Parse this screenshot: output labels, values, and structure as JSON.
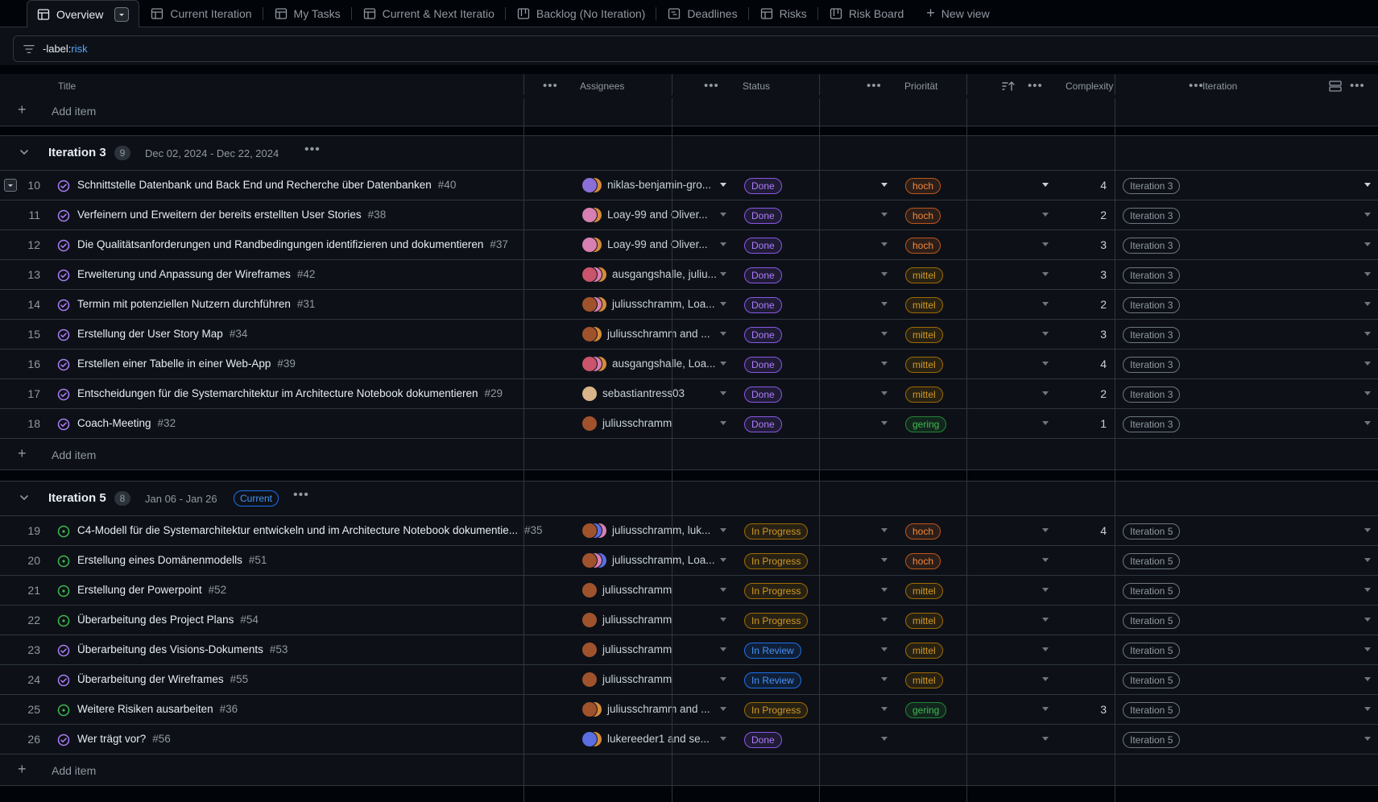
{
  "tabs": [
    {
      "label": "Overview",
      "icon": "table-icon",
      "active": true
    },
    {
      "label": "Current Iteration",
      "icon": "table-icon"
    },
    {
      "label": "My Tasks",
      "icon": "table-icon"
    },
    {
      "label": "Current & Next Iteratio",
      "icon": "table-icon"
    },
    {
      "label": "Backlog (No Iteration)",
      "icon": "board-icon"
    },
    {
      "label": "Deadlines",
      "icon": "roadmap-icon"
    },
    {
      "label": "Risks",
      "icon": "table-icon"
    },
    {
      "label": "Risk Board",
      "icon": "board-icon"
    }
  ],
  "new_view_label": "New view",
  "filter": {
    "key": "-label:",
    "value": "risk"
  },
  "columns": {
    "title": "Title",
    "assignees": "Assignees",
    "status": "Status",
    "priority": "Priorität",
    "complexity": "Complexity",
    "iteration": "Iteration"
  },
  "add_item_label": "Add item",
  "groups": [
    {
      "title": "Iteration 3",
      "count": "9",
      "dates": "Dec 02, 2024 - Dec 22, 2024",
      "badge": "",
      "items": [
        {
          "n": "10",
          "state": "done",
          "title": "Schnittstelle Datenbank und Back End und Recherche über Datenbanken",
          "issue": "#40",
          "avatars": [
            "purple",
            "orange"
          ],
          "assignees": "niklas-benjamin-gro...",
          "status": "Done",
          "priority": "hoch",
          "complexity": "4",
          "iteration": "Iteration 3"
        },
        {
          "n": "11",
          "state": "done",
          "title": "Verfeinern und Erweitern der bereits erstellten User Stories",
          "issue": "#38",
          "avatars": [
            "pink",
            "orange"
          ],
          "assignees": "Loay-99 and Oliver...",
          "status": "Done",
          "priority": "hoch",
          "complexity": "2",
          "iteration": "Iteration 3"
        },
        {
          "n": "12",
          "state": "done",
          "title": "Die Qualitätsanforderungen und Randbedingungen identifizieren und dokumentieren",
          "issue": "#37",
          "avatars": [
            "pink",
            "orange"
          ],
          "assignees": "Loay-99 and Oliver...",
          "status": "Done",
          "priority": "hoch",
          "complexity": "3",
          "iteration": "Iteration 3"
        },
        {
          "n": "13",
          "state": "done",
          "title": "Erweiterung und Anpassung der Wireframes",
          "issue": "#42",
          "avatars": [
            "red",
            "pink",
            "orange"
          ],
          "assignees": "ausgangshalle, juliu...",
          "status": "Done",
          "priority": "mittel",
          "complexity": "3",
          "iteration": "Iteration 3"
        },
        {
          "n": "14",
          "state": "done",
          "title": "Termin mit potenziellen Nutzern durchführen",
          "issue": "#31",
          "avatars": [
            "brown",
            "pink",
            "orange"
          ],
          "assignees": "juliusschramm, Loa...",
          "status": "Done",
          "priority": "mittel",
          "complexity": "2",
          "iteration": "Iteration 3"
        },
        {
          "n": "15",
          "state": "done",
          "title": "Erstellung der User Story Map",
          "issue": "#34",
          "avatars": [
            "brown",
            "orange"
          ],
          "assignees": "juliusschramm and ...",
          "status": "Done",
          "priority": "mittel",
          "complexity": "3",
          "iteration": "Iteration 3"
        },
        {
          "n": "16",
          "state": "done",
          "title": "Erstellen einer Tabelle in einer Web-App",
          "issue": "#39",
          "avatars": [
            "red",
            "pink",
            "orange"
          ],
          "assignees": "ausgangshalle, Loa...",
          "status": "Done",
          "priority": "mittel",
          "complexity": "4",
          "iteration": "Iteration 3"
        },
        {
          "n": "17",
          "state": "done",
          "title": "Entscheidungen für die Systemarchitektur im Architecture Notebook dokumentieren",
          "issue": "#29",
          "avatars": [
            "tan"
          ],
          "assignees": "sebastiantress03",
          "status": "Done",
          "priority": "mittel",
          "complexity": "2",
          "iteration": "Iteration 3"
        },
        {
          "n": "18",
          "state": "done",
          "title": "Coach-Meeting",
          "issue": "#32",
          "avatars": [
            "brown"
          ],
          "assignees": "juliusschramm",
          "status": "Done",
          "priority": "gering",
          "complexity": "1",
          "iteration": "Iteration 3"
        }
      ]
    },
    {
      "title": "Iteration 5",
      "count": "8",
      "dates": "Jan 06 - Jan 26",
      "badge": "Current",
      "items": [
        {
          "n": "19",
          "state": "open",
          "title": "C4-Modell für die Systemarchitektur entwickeln und im Architecture Notebook dokumentie...",
          "issue": "#35",
          "avatars": [
            "brown",
            "blue",
            "pink"
          ],
          "assignees": "juliusschramm, luk...",
          "status": "In Progress",
          "priority": "hoch",
          "complexity": "4",
          "iteration": "Iteration 5"
        },
        {
          "n": "20",
          "state": "open",
          "title": "Erstellung eines Domänenmodells",
          "issue": "#51",
          "avatars": [
            "brown",
            "pink",
            "blue"
          ],
          "assignees": "juliusschramm, Loa...",
          "status": "In Progress",
          "priority": "hoch",
          "complexity": "",
          "iteration": "Iteration 5"
        },
        {
          "n": "21",
          "state": "open",
          "title": "Erstellung der Powerpoint",
          "issue": "#52",
          "avatars": [
            "brown"
          ],
          "assignees": "juliusschramm",
          "status": "In Progress",
          "priority": "mittel",
          "complexity": "",
          "iteration": "Iteration 5"
        },
        {
          "n": "22",
          "state": "open",
          "title": "Überarbeitung des Project Plans",
          "issue": "#54",
          "avatars": [
            "brown"
          ],
          "assignees": "juliusschramm",
          "status": "In Progress",
          "priority": "mittel",
          "complexity": "",
          "iteration": "Iteration 5"
        },
        {
          "n": "23",
          "state": "done",
          "title": "Überarbeitung des Visions-Dokuments",
          "issue": "#53",
          "avatars": [
            "brown"
          ],
          "assignees": "juliusschramm",
          "status": "In Review",
          "priority": "mittel",
          "complexity": "",
          "iteration": "Iteration 5"
        },
        {
          "n": "24",
          "state": "done",
          "title": "Überarbeitung der Wireframes",
          "issue": "#55",
          "avatars": [
            "brown"
          ],
          "assignees": "juliusschramm",
          "status": "In Review",
          "priority": "mittel",
          "complexity": "",
          "iteration": "Iteration 5"
        },
        {
          "n": "25",
          "state": "open",
          "title": "Weitere Risiken ausarbeiten",
          "issue": "#36",
          "avatars": [
            "brown",
            "orange"
          ],
          "assignees": "juliusschramm and ...",
          "status": "In Progress",
          "priority": "gering",
          "complexity": "3",
          "iteration": "Iteration 5"
        },
        {
          "n": "26",
          "state": "done",
          "title": "Wer trägt vor?",
          "issue": "#56",
          "avatars": [
            "blue",
            "orange"
          ],
          "assignees": "lukereeder1 and se...",
          "status": "Done",
          "priority": "",
          "complexity": "",
          "iteration": "Iteration 5"
        }
      ]
    }
  ],
  "colors": {
    "done_purple": "#ab7df8",
    "open_green": "#3fb950",
    "accent_blue": "#4493f8",
    "hoch": "#f0883e",
    "mittel": "#d29922",
    "gering": "#3fb950"
  }
}
